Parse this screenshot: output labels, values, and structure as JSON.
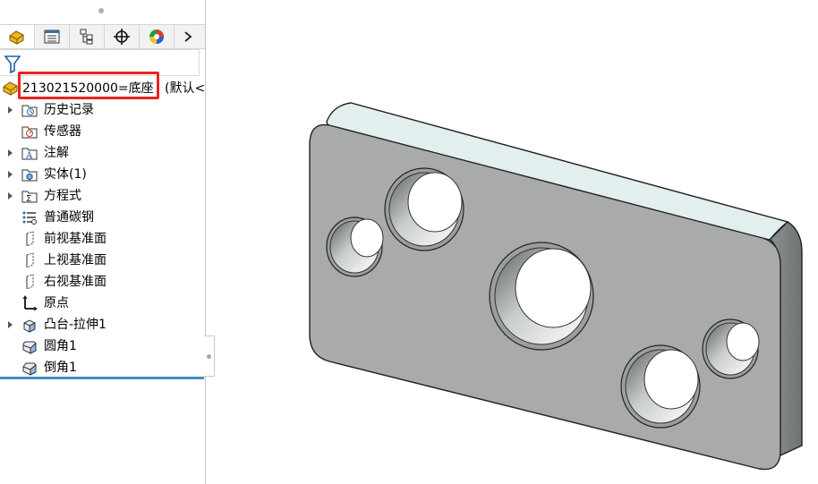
{
  "feature_tree": {
    "tabs": [
      {
        "icon": "feature-manager-icon",
        "active": true
      },
      {
        "icon": "property-manager-icon",
        "active": false
      },
      {
        "icon": "configuration-manager-icon",
        "active": false
      },
      {
        "icon": "dimxpert-icon",
        "active": false
      },
      {
        "icon": "display-manager-icon",
        "active": false
      }
    ],
    "more_icon": "chevron-right-icon",
    "filter_icon": "filter-icon",
    "root": {
      "name": "213021520000=底座",
      "config": "(默认<"
    },
    "items": [
      {
        "label": "历史记录",
        "icon": "history-folder-icon",
        "expandable": true
      },
      {
        "label": "传感器",
        "icon": "sensor-icon",
        "expandable": false
      },
      {
        "label": "注解",
        "icon": "annotation-icon",
        "expandable": true
      },
      {
        "label": "实体(1)",
        "icon": "solid-bodies-icon",
        "expandable": true
      },
      {
        "label": "方程式",
        "icon": "equations-icon",
        "expandable": true
      },
      {
        "label": "普通碳钢",
        "icon": "material-icon",
        "expandable": false
      },
      {
        "label": "前视基准面",
        "icon": "plane-icon",
        "expandable": false
      },
      {
        "label": "上视基准面",
        "icon": "plane-icon",
        "expandable": false
      },
      {
        "label": "右视基准面",
        "icon": "plane-icon",
        "expandable": false
      },
      {
        "label": "原点",
        "icon": "origin-icon",
        "expandable": false
      },
      {
        "label": "凸台-拉伸1",
        "icon": "boss-extrude-icon",
        "expandable": true
      },
      {
        "label": "圆角1",
        "icon": "fillet-icon",
        "expandable": false
      },
      {
        "label": "倒角1",
        "icon": "chamfer-icon",
        "expandable": false
      }
    ]
  },
  "colors": {
    "highlight_box": "#e8231f",
    "rollback_bar": "#3e8ec4",
    "part_face": "#a9abaa",
    "part_top": "#e3eeee"
  }
}
